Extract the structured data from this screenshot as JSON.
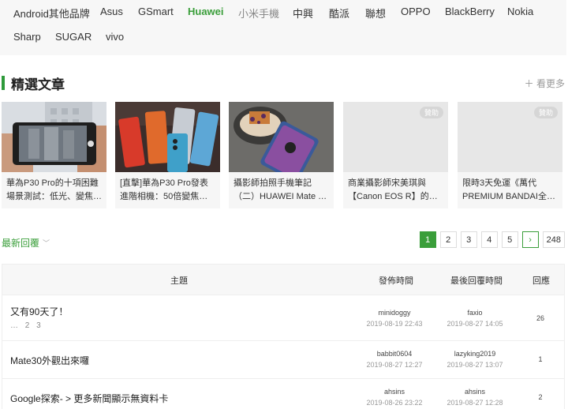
{
  "brands": {
    "row1": [
      {
        "label": "Android其他品牌",
        "state": "normal"
      },
      {
        "label": "Asus",
        "state": "normal"
      },
      {
        "label": "GSmart",
        "state": "normal"
      },
      {
        "label": "Huawei",
        "state": "active"
      },
      {
        "label": "小米手機",
        "state": "muted"
      },
      {
        "label": "中興",
        "state": "normal"
      },
      {
        "label": "酷派",
        "state": "normal"
      },
      {
        "label": "聯想",
        "state": "normal"
      },
      {
        "label": "OPPO",
        "state": "normal"
      },
      {
        "label": "BlackBerry",
        "state": "normal"
      },
      {
        "label": "Nokia",
        "state": "normal"
      }
    ],
    "row2": [
      {
        "label": "Sharp",
        "state": "normal"
      },
      {
        "label": "SUGAR",
        "state": "normal"
      },
      {
        "label": "vivo",
        "state": "normal"
      }
    ]
  },
  "featured": {
    "title": "精選文章",
    "see_more": "＋ 看更多",
    "cards": [
      {
        "line1": "華為P30 Pro的十項困難",
        "line2": "場景測試：低光、變焦…",
        "sponsor": ""
      },
      {
        "line1": "[直擊]華為P30 Pro發表",
        "line2": "進階相機：50倍變焦、…",
        "sponsor": ""
      },
      {
        "line1": "攝影師拍照手機筆記",
        "line2": "（二）HUAWEI Mate 2…",
        "sponsor": ""
      },
      {
        "line1": "商業攝影師宋美琪與",
        "line2": "【Canon EOS R】的初…",
        "sponsor": "贊助"
      },
      {
        "line1": "限時3天免運《萬代",
        "line2": "PREMIUM BANDAI全…",
        "sponsor": "贊助"
      }
    ]
  },
  "replies": {
    "sort_label": "最新回覆",
    "pager": [
      "1",
      "2",
      "3",
      "4",
      "5",
      "›",
      "248"
    ],
    "current_page": "1"
  },
  "table": {
    "headers": {
      "topic": "主題",
      "posted": "發佈時間",
      "last_reply": "最後回覆時間",
      "replies": "回應"
    },
    "rows": [
      {
        "topic": "又有90天了！",
        "pages": [
          "…",
          "2",
          "3"
        ],
        "author": "minidoggy",
        "posted": "2019-08-19 22:43",
        "last_user": "faxio",
        "last_time": "2019-08-27 14:05",
        "count": "26"
      },
      {
        "topic": "Mate30外觀出來囉",
        "pages": [],
        "author": "babbit0604",
        "posted": "2019-08-27 12:27",
        "last_user": "lazyking2019",
        "last_time": "2019-08-27 13:07",
        "count": "1"
      },
      {
        "topic": "Google探索- > 更多新聞顯示無資料卡",
        "pages": [],
        "author": "ahsins",
        "posted": "2019-08-26 23:22",
        "last_user": "ahsins",
        "last_time": "2019-08-27 12:28",
        "count": "2"
      }
    ]
  },
  "colors": {
    "accent": "#3a9e3a"
  }
}
